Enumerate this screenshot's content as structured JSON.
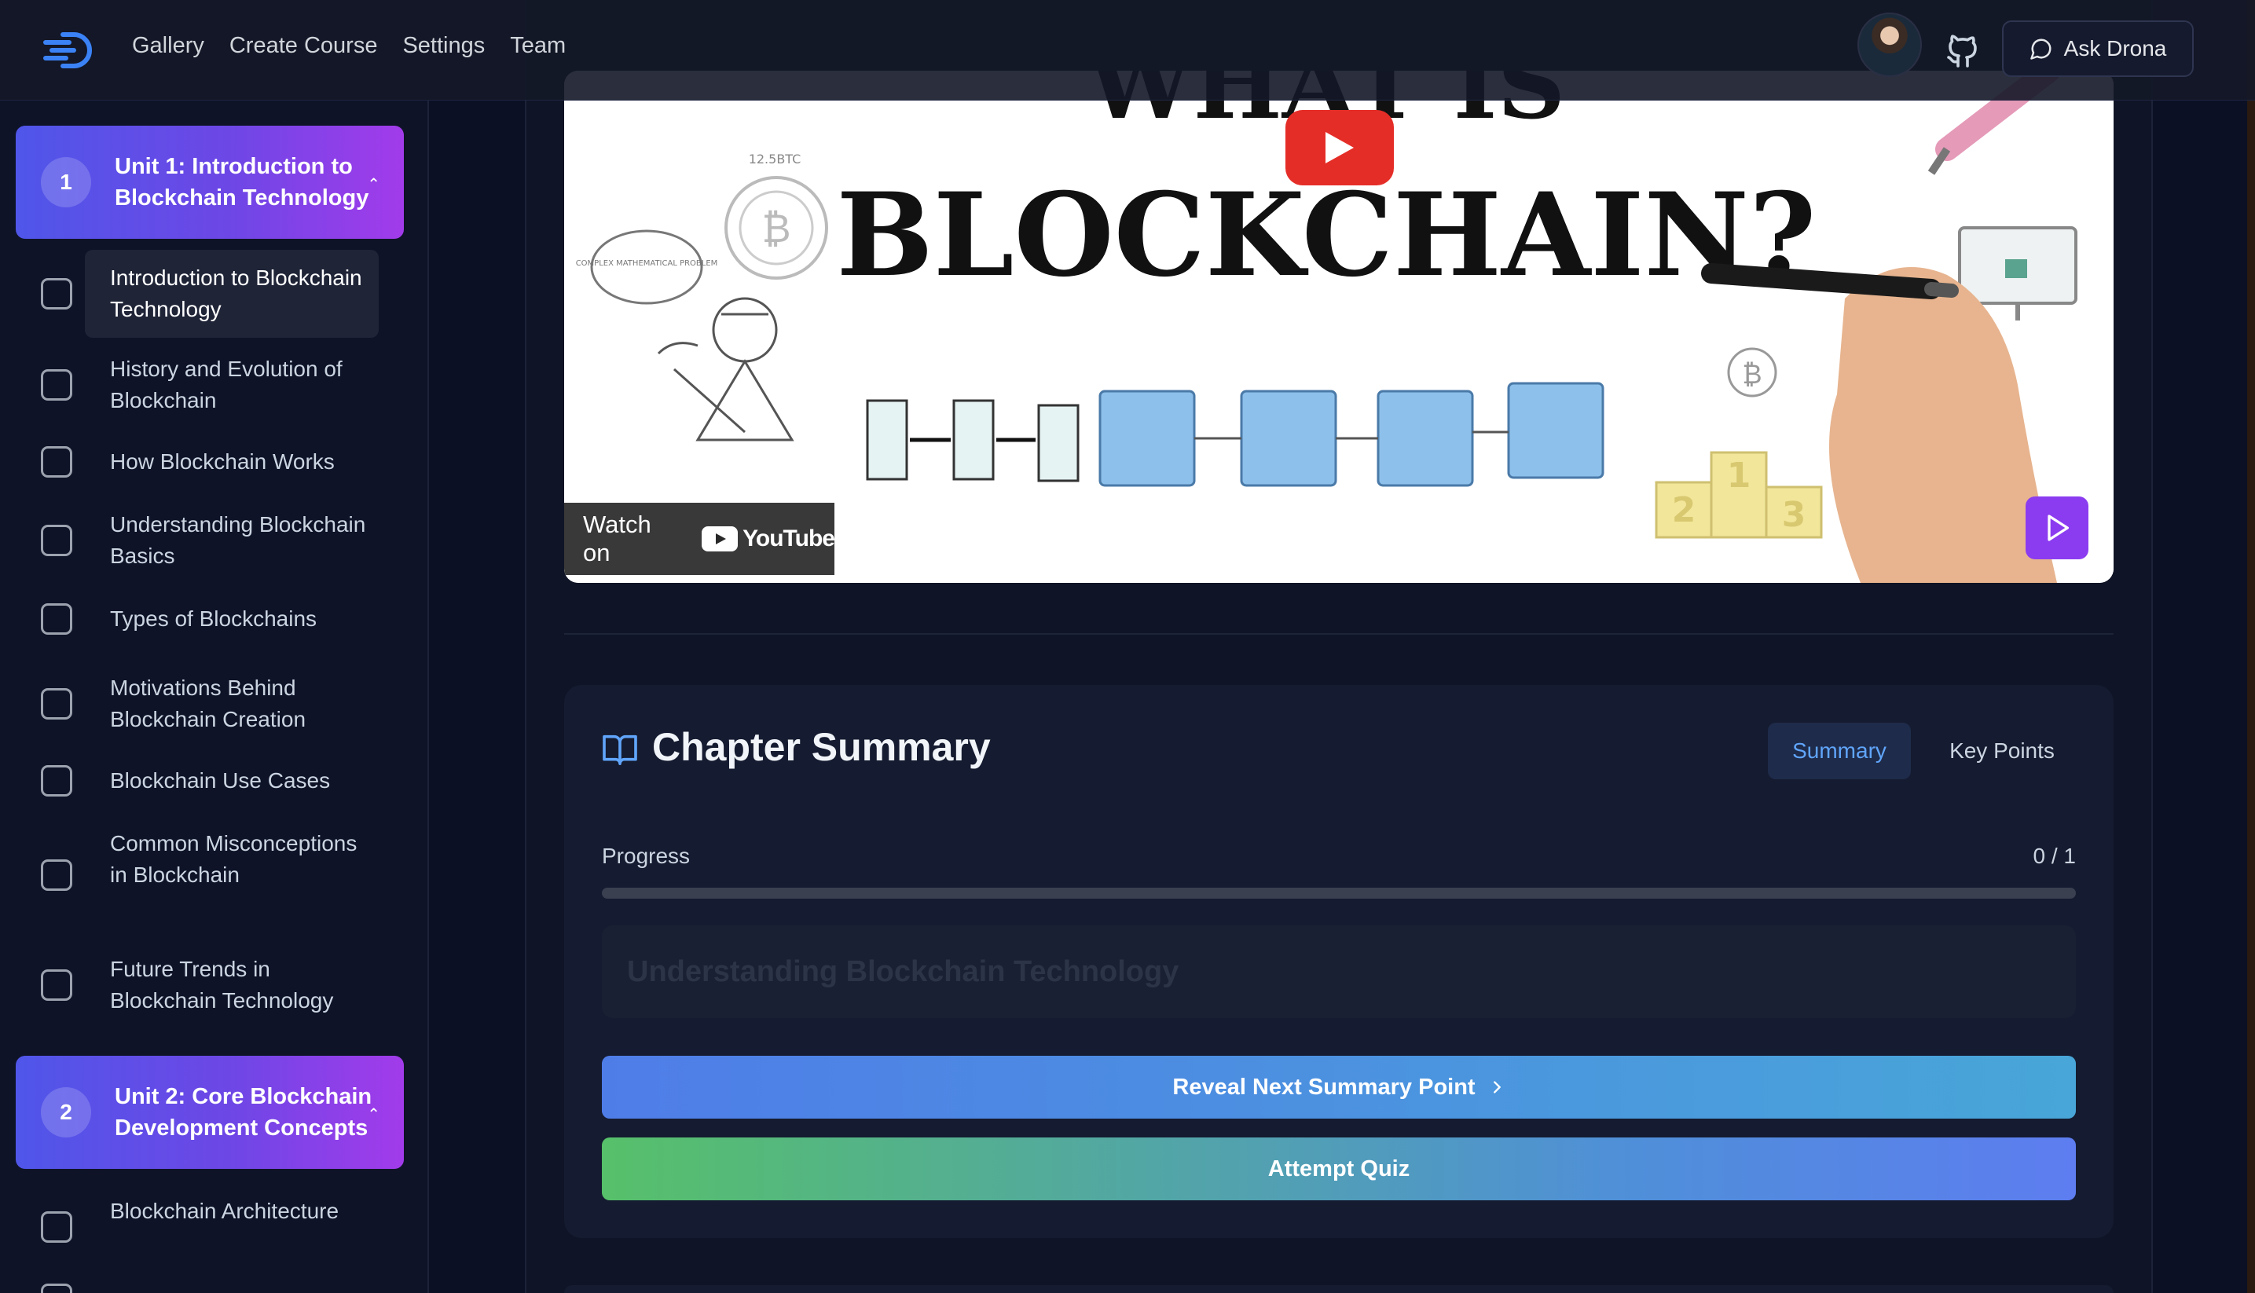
{
  "header": {
    "nav": [
      "Gallery",
      "Create Course",
      "Settings",
      "Team"
    ],
    "ask_label": "Ask Drona"
  },
  "sidebar": {
    "units": [
      {
        "number": "1",
        "title": "Unit 1: Introduction to Blockchain Technology",
        "chapters": [
          "Introduction to Blockchain Technology",
          "History and Evolution of Blockchain",
          "How Blockchain Works",
          "Understanding Blockchain Basics",
          "Types of Blockchains",
          "Motivations Behind Blockchain Creation",
          "Blockchain Use Cases",
          "Common Misconceptions in Blockchain",
          "Future Trends in Blockchain Technology"
        ]
      },
      {
        "number": "2",
        "title": "Unit 2: Core Blockchain Development Concepts",
        "chapters": [
          "Blockchain Architecture"
        ]
      }
    ]
  },
  "video": {
    "headline_top": "WHAT IS",
    "headline": "BLOCKCHAIN?",
    "watch_on": "Watch on",
    "youtube": "YouTube",
    "coin_label": "12.5BTC",
    "cloud_text": "COMPLEX MATHEMATICAL PROBLEM",
    "podium": [
      "2",
      "1",
      "3"
    ]
  },
  "summary": {
    "title": "Chapter Summary",
    "tab_summary": "Summary",
    "tab_key_points": "Key Points",
    "progress_label": "Progress",
    "progress_value": "0 / 1",
    "progress_fraction": 0,
    "point_text": "Understanding Blockchain Technology",
    "reveal_label": "Reveal Next Summary Point",
    "quiz_label": "Attempt Quiz"
  },
  "colors": {
    "accent_gradient_start": "#4f56e9",
    "accent_gradient_end": "#a23bea",
    "reveal_gradient": [
      "#4f7de8",
      "#48a6d8"
    ],
    "quiz_gradient": [
      "#56c06a",
      "#5d7df0"
    ],
    "youtube_red": "#e52d27"
  }
}
